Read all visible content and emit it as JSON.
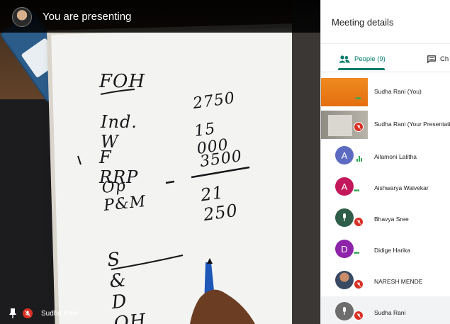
{
  "presenting_bar": {
    "text": "You are presenting",
    "avatar_icon": "user-avatar"
  },
  "video": {
    "name_label": "Sudha Rani",
    "pin_icon": "pin-icon",
    "mic_icon": "mic-off-icon",
    "whiteboard_lines": [
      {
        "left": "FOH",
        "right": ""
      },
      {
        "left": "Ind. W",
        "right": "2750"
      },
      {
        "left": "F RRP",
        "right": "15 000"
      },
      {
        "left": "Op P&M",
        "right": "3500"
      },
      {
        "left": "",
        "right": "21 250"
      },
      {
        "left": "S & D OH",
        "right": ""
      }
    ]
  },
  "panel": {
    "title": "Meeting details",
    "tabs": [
      {
        "label": "People (9)",
        "icon": "people-icon",
        "active": true
      },
      {
        "label": "Ch",
        "icon": "chat-icon",
        "active": false
      }
    ],
    "participants": [
      {
        "name": "Sudha Rani (You)",
        "avatar": "video-thumbnail",
        "status": "more-dots"
      },
      {
        "name": "Sudha Rani (Your Presentati",
        "avatar": "presentation-thumbnail",
        "status": "mic-off"
      },
      {
        "name": "Ailamoni Lalitha",
        "avatar_letter": "A",
        "color": "#5c6bc0",
        "status": "speaking"
      },
      {
        "name": "Aishwarya Walvekar",
        "avatar_letter": "A",
        "color": "#c2185b",
        "status": "more-dots"
      },
      {
        "name": "Bhavya Sree",
        "avatar": "bhavya-photo",
        "status": "mic-off"
      },
      {
        "name": "Didige Harika",
        "avatar_letter": "D",
        "color": "#8e24aa",
        "status": "more-dots"
      },
      {
        "name": "NARESH MENDE",
        "avatar": "naresh-photo",
        "status": "mic-off"
      },
      {
        "name": "Sudha Rani",
        "avatar": "sudha-photo",
        "status": "mic-off"
      }
    ]
  },
  "colors": {
    "accent": "#00796b",
    "mute_red": "#d93025",
    "speaking_green": "#34a853"
  }
}
